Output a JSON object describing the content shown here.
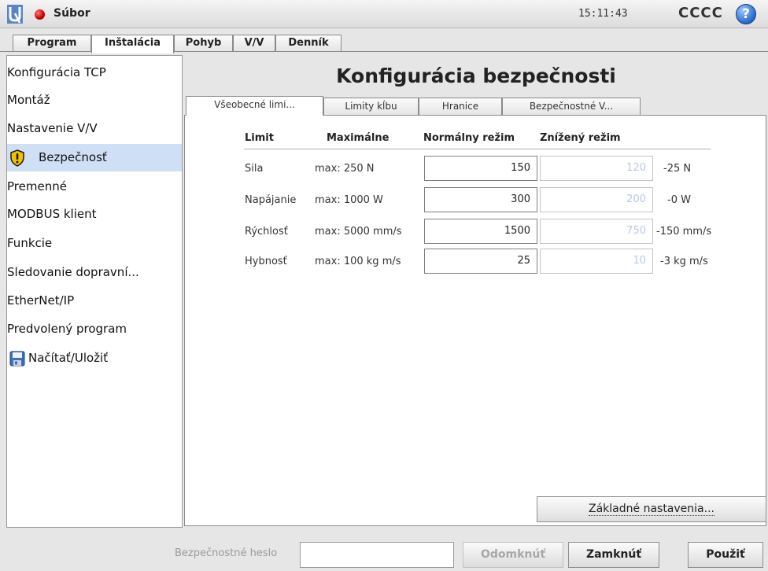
{
  "header": {
    "file_menu": "Súbor",
    "clock": "15:11:43",
    "robot_name": "CCCC",
    "help_glyph": "?"
  },
  "main_tabs": [
    {
      "label": "Program"
    },
    {
      "label": "Inštalácia"
    },
    {
      "label": "Pohyb"
    },
    {
      "label": "V/V"
    },
    {
      "label": "Denník"
    }
  ],
  "sidebar": {
    "items": [
      {
        "label": "Konfigurácia TCP"
      },
      {
        "label": "Montáž"
      },
      {
        "label": "Nastavenie V/V"
      },
      {
        "label": "Bezpečnosť",
        "icon": "warning-shield-icon",
        "selected": true
      },
      {
        "label": "Premenné"
      },
      {
        "label": "MODBUS klient"
      },
      {
        "label": "Funkcie"
      },
      {
        "label": "Sledovanie dopravní..."
      },
      {
        "label": "EtherNet/IP"
      },
      {
        "label": "Predvolený program"
      },
      {
        "label": "Načítať/Uložiť",
        "icon": "floppy-disk-icon"
      }
    ]
  },
  "content": {
    "title": "Konfigurácia bezpečnosti",
    "subtabs": [
      {
        "label": "Všeobecné limi..."
      },
      {
        "label": "Limity kĺbu"
      },
      {
        "label": "Hranice"
      },
      {
        "label": "Bezpečnostné V..."
      }
    ],
    "table": {
      "headers": {
        "limit": "Limit",
        "max": "Maximálne",
        "normal": "Normálny režim",
        "reduced": "Znížený režim"
      },
      "rows": [
        {
          "name": "Sila",
          "max": "max: 250 N",
          "normal": "150",
          "reduced": "120",
          "diff": "-25 N"
        },
        {
          "name": "Napájanie",
          "max": "max: 1000 W",
          "normal": "300",
          "reduced": "200",
          "diff": "-0 W"
        },
        {
          "name": "Rýchlosť",
          "max": "max: 5000 mm/s",
          "normal": "1500",
          "reduced": "750",
          "diff": "-150 mm/s"
        },
        {
          "name": "Hybnosť",
          "max": "max: 100 kg m/s",
          "normal": "25",
          "reduced": "10",
          "diff": "-3 kg m/s"
        }
      ]
    },
    "defaults_button": "Základné nastavenia..."
  },
  "bottom": {
    "password_label": "Bezpečnostné heslo",
    "password_value": "",
    "unlock_label": "Odomknúť",
    "lock_label": "Zamknúť",
    "apply_label": "Použiť"
  },
  "colors": {
    "selection": "#cfe0f6",
    "reduced_text": "#b6c8e6",
    "status_dot": "#d00000",
    "help_blue": "#2f6fd0"
  }
}
